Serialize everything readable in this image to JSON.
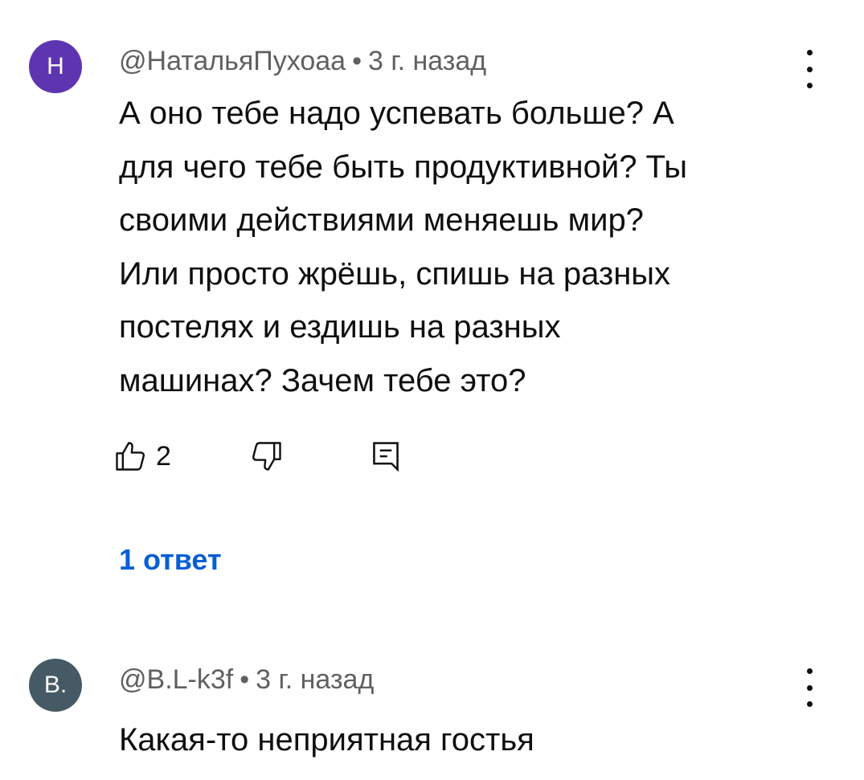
{
  "comments": [
    {
      "avatar_letter": "Н",
      "avatar_color": "#5e35b1",
      "author": "@НатальяПухоаа",
      "separator": "•",
      "time": "3 г. назад",
      "lines": [
        "А оно тебе надо успевать больше? А",
        "для чего тебе быть продуктивной? Ты",
        "своими действиями меняешь мир?",
        "Или просто жрёшь, спишь на разных",
        "постелях и ездишь на разных",
        "машинах? Зачем тебе это?"
      ],
      "like_count": "2",
      "replies_label": "1 ответ",
      "icons": {
        "more": "more-vertical-icon",
        "like": "thumbs-up-icon",
        "dislike": "thumbs-down-icon",
        "reply": "comment-reply-icon"
      }
    },
    {
      "avatar_letter": "B.",
      "avatar_color": "#455a64",
      "author": "@B.L-k3f",
      "separator": "•",
      "time": "3 г. назад",
      "lines": [
        "Какая-то неприятная гостья"
      ],
      "icons": {
        "more": "more-vertical-icon"
      }
    }
  ],
  "colors": {
    "link": "#065fd4",
    "meta_text": "#606060",
    "body_text": "#0f0f0f"
  }
}
